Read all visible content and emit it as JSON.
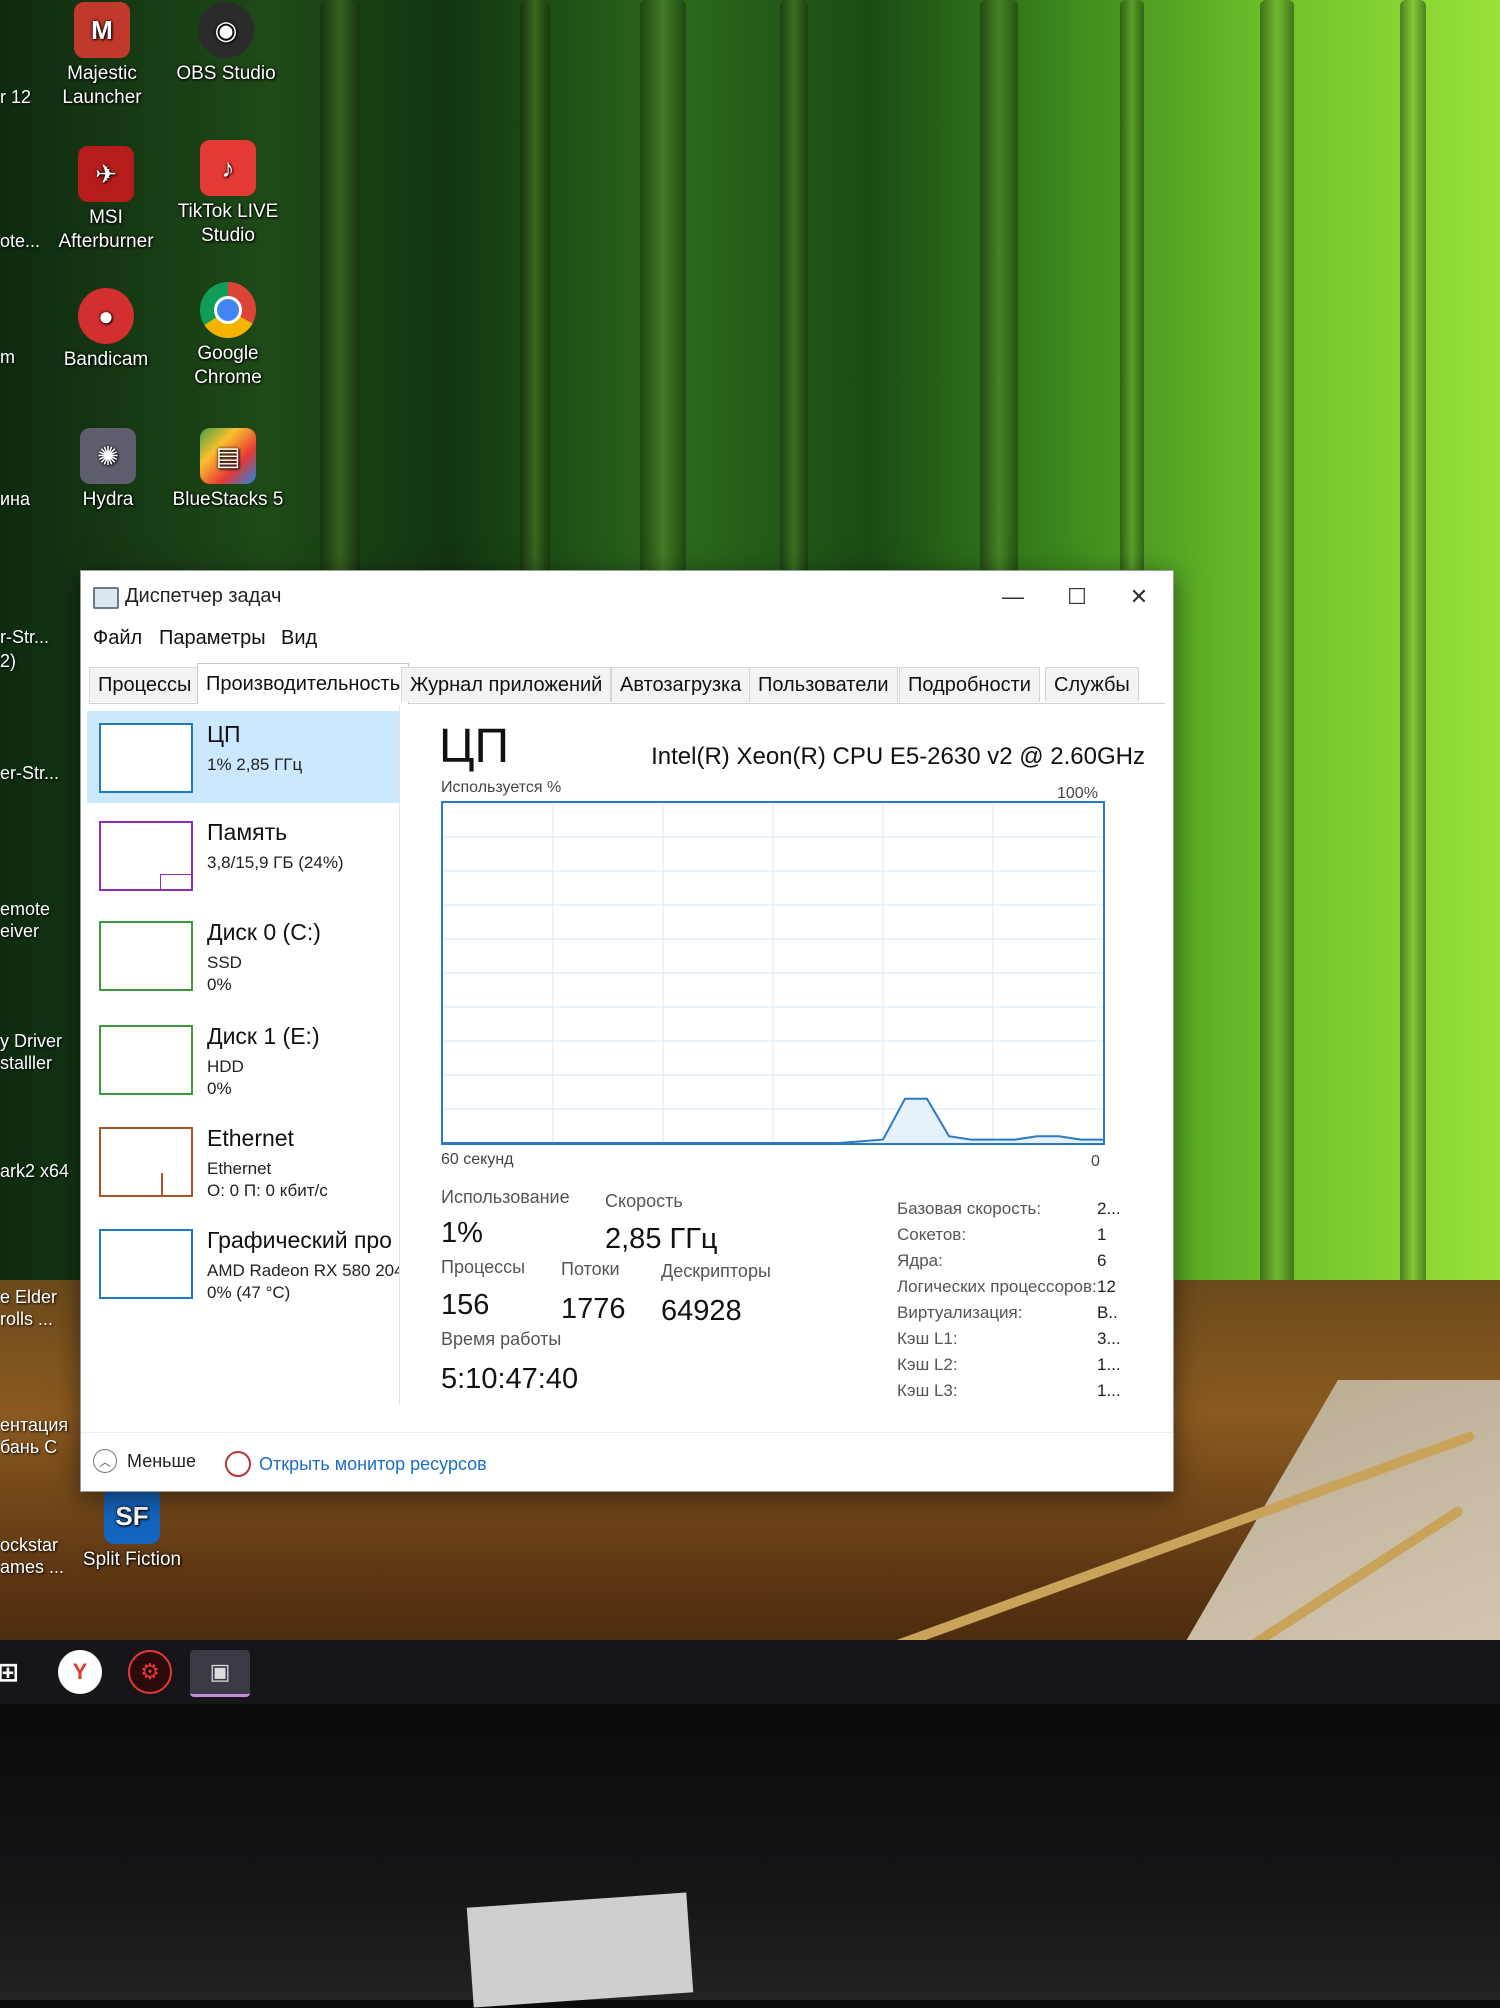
{
  "desktop_icons": [
    {
      "label_1": "Majestic",
      "label_2": "Launcher",
      "icon": "majestic-launcher-icon",
      "color": "#c0392b"
    },
    {
      "label_1": "OBS Studio",
      "label_2": "",
      "icon": "obs-studio-icon",
      "color": "#2b2b2b"
    },
    {
      "label_1": "MSI",
      "label_2": "Afterburner",
      "icon": "msi-afterburner-icon",
      "color": "#b71c1c"
    },
    {
      "label_1": "TikTok LIVE",
      "label_2": "Studio",
      "icon": "tiktok-live-studio-icon",
      "color": "#e53935"
    },
    {
      "label_1": "Bandicam",
      "label_2": "",
      "icon": "bandicam-icon",
      "color": "#d32f2f"
    },
    {
      "label_1": "Google",
      "label_2": "Chrome",
      "icon": "google-chrome-icon",
      "color": "#1e88e5"
    },
    {
      "label_1": "Hydra",
      "label_2": "",
      "icon": "hydra-icon",
      "color": "#5e5e6e"
    },
    {
      "label_1": "BlueStacks 5",
      "label_2": "",
      "icon": "bluestacks-icon",
      "color": "#43a047"
    },
    {
      "label_1": "Split Fiction",
      "label_2": "",
      "icon": "split-fiction-icon",
      "color": "#1565c0"
    }
  ],
  "partial_labels": [
    "r 12",
    "ote...",
    "m",
    "ина",
    "r-Str...",
    "2)",
    "er-Str...",
    "emote",
    "eiver",
    "y Driver",
    "stalller",
    "ark2 x64",
    "e Elder",
    "rolls ...",
    "ентация",
    "бань С",
    "ockstar",
    "ames ..."
  ],
  "window": {
    "title": "Диспетчер задач",
    "menu": [
      "Файл",
      "Параметры",
      "Вид"
    ],
    "tabs": [
      "Процессы",
      "Производительность",
      "Журнал приложений",
      "Автозагрузка",
      "Пользователи",
      "Подробности",
      "Службы"
    ],
    "active_tab": "Производительность"
  },
  "sidebar": [
    {
      "title": "ЦП",
      "sub1": "1% 2,85 ГГц",
      "sub2": "",
      "color": "#1f7ac4",
      "selected": true
    },
    {
      "title": "Память",
      "sub1": "3,8/15,9 ГБ (24%)",
      "sub2": "",
      "color": "#8b2fb0"
    },
    {
      "title": "Диск 0 (C:)",
      "sub1": "SSD",
      "sub2": "0%",
      "color": "#3d9a3d"
    },
    {
      "title": "Диск 1 (E:)",
      "sub1": "HDD",
      "sub2": "0%",
      "color": "#3d9a3d"
    },
    {
      "title": "Ethernet",
      "sub1": "Ethernet",
      "sub2": "О: 0 П: 0 кбит/с",
      "color": "#a8552b"
    },
    {
      "title": "Графический про",
      "sub1": "AMD Radeon RX 580 204",
      "sub2": "0% (47 °C)",
      "color": "#1f7ac4"
    }
  ],
  "cpu": {
    "title": "ЦП",
    "model": "Intel(R) Xeon(R) CPU E5-2630 v2 @ 2.60GHz",
    "graph_label_left": "Используется %",
    "graph_label_right": "100%",
    "graph_bottom_left": "60 секунд",
    "graph_bottom_right": "0",
    "usage_label": "Использование",
    "usage": "1%",
    "speed_label": "Скорость",
    "speed": "2,85 ГГц",
    "processes_label": "Процессы",
    "processes": "156",
    "threads_label": "Потоки",
    "threads": "1776",
    "handles_label": "Дескрипторы",
    "handles": "64928",
    "uptime_label": "Время работы",
    "uptime": "5:10:47:40",
    "specs": [
      {
        "k": "Базовая скорость:",
        "v": "2..."
      },
      {
        "k": "Сокетов:",
        "v": "1"
      },
      {
        "k": "Ядра:",
        "v": "6"
      },
      {
        "k": "Логических процессоров:",
        "v": "12"
      },
      {
        "k": "Виртуализация:",
        "v": "В.."
      },
      {
        "k": "Кэш L1:",
        "v": "3..."
      },
      {
        "k": "Кэш L2:",
        "v": "1..."
      },
      {
        "k": "Кэш L3:",
        "v": "1..."
      }
    ]
  },
  "footer": {
    "less": "Меньше",
    "monitor": "Открыть монитор ресурсов"
  },
  "chart_data": {
    "type": "line",
    "title": "ЦП",
    "xlabel": "60 секунд",
    "ylabel": "Используется %",
    "ylim": [
      0,
      100
    ],
    "x": [
      0,
      6,
      12,
      18,
      24,
      30,
      36,
      40,
      42,
      44,
      46,
      48,
      50,
      52,
      54,
      56,
      58,
      60
    ],
    "values": [
      0,
      0,
      0,
      0,
      0,
      0,
      0,
      1,
      13,
      13,
      2,
      1,
      1,
      1,
      2,
      2,
      1,
      1
    ]
  }
}
